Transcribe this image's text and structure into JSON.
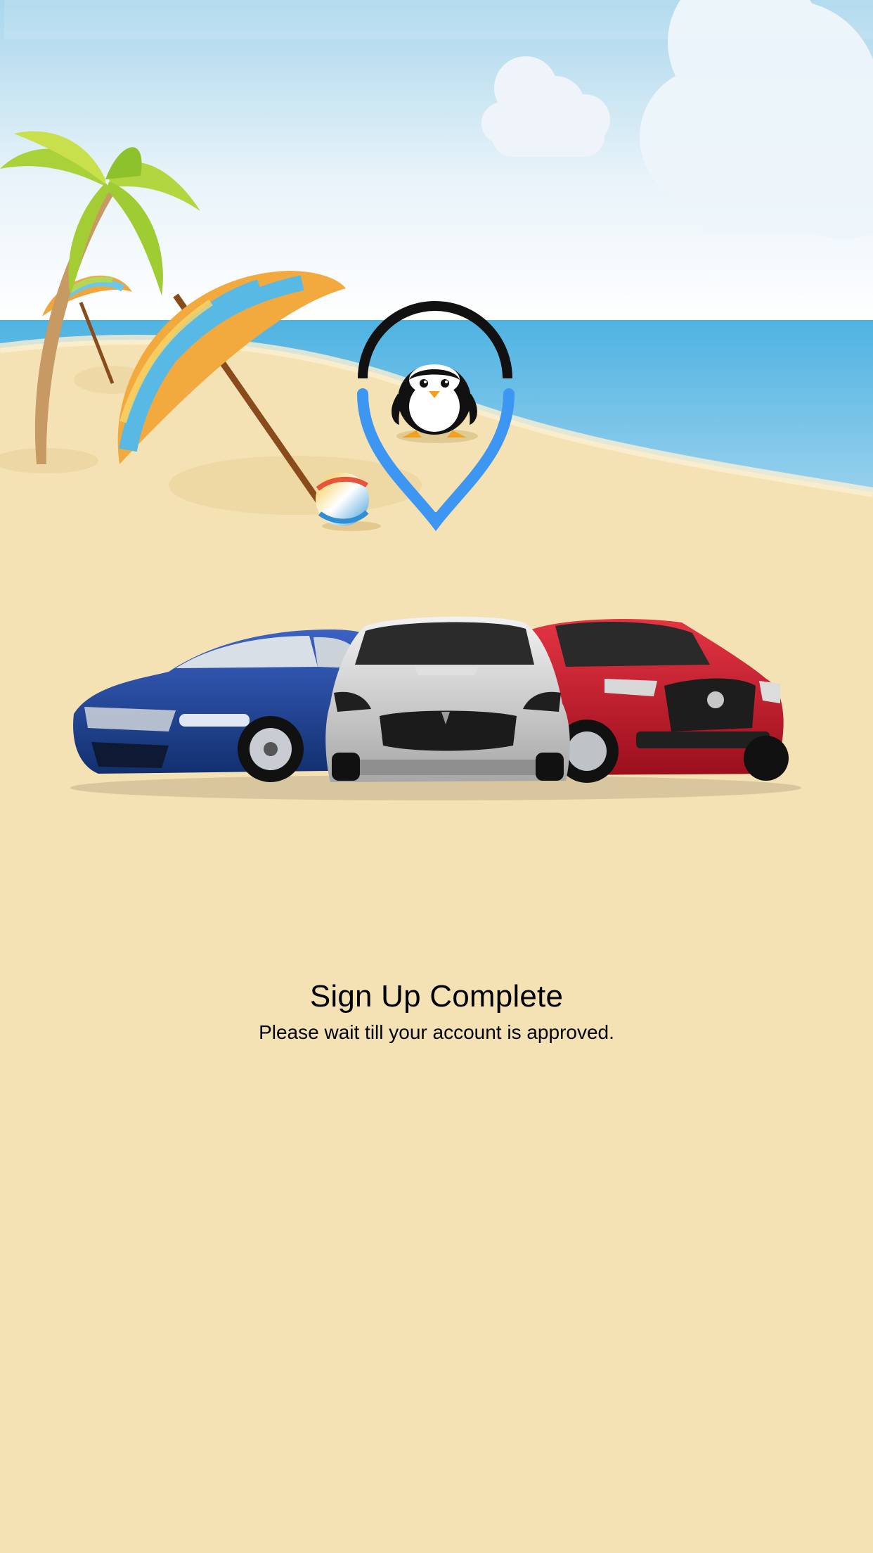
{
  "colors": {
    "sky_top": "#a9d6ec",
    "sky_bottom": "#ffffff",
    "sea": "#5bb8e4",
    "sand": "#f5e2b4",
    "pin_blue": "#3d96f2",
    "car_blue": "#1b3f8f",
    "car_silver": "#c8c8c8",
    "car_red": "#c8182c"
  },
  "illustration": {
    "icons": [
      "palm-tree-icon",
      "beach-umbrella-icon",
      "beach-ball-icon",
      "cloud-icon",
      "map-pin-icon",
      "penguin-icon",
      "car-icon"
    ]
  },
  "confirmation": {
    "title": "Sign Up Complete",
    "subtitle": "Please wait till your account is approved."
  }
}
